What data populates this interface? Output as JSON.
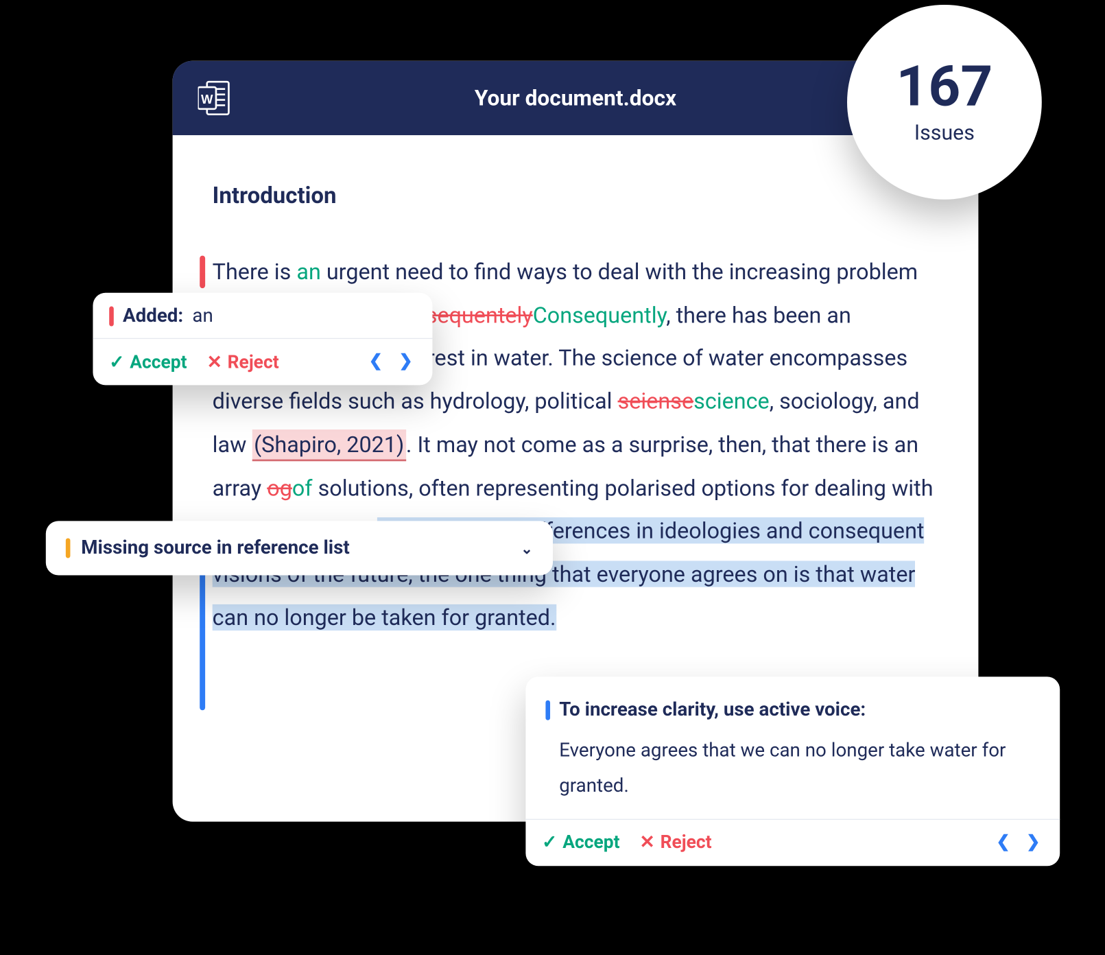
{
  "header": {
    "filename": "Your document.docx"
  },
  "issues": {
    "count": "167",
    "label": "Issues"
  },
  "content": {
    "heading": "Introduction",
    "p1_pre": "There is ",
    "p1_ins_an": "an",
    "p1_after_an": " urgent need to find ways to deal with the increasing problem of water scarcity. ",
    "p1_del_conseq": "Consequentely",
    "p1_ins_conseq": "Consequently",
    "p1_after_conseq": ", there has been an increase in global interest in water. The science of water encompasses diverse fields such as hydrology, political ",
    "p1_del_sci": "seiense",
    "p1_ins_sci": "science",
    "p1_after_sci": ", sociology, and law ",
    "p1_citation": "(Shapiro, 2021)",
    "p1_after_cite": ". It may not come as a surprise, then, that there is an array ",
    "p1_del_og": "og",
    "p1_ins_of": "of",
    "p1_after_of": " solutions, often representing polarised options for dealing with water problems.  ",
    "p1_blue_sel": "Regardless of differences in ideologies and consequent visions of the future, the one thing that everyone agrees on is that water can no longer be taken for granted."
  },
  "popups": {
    "added": {
      "label": "Added:",
      "word": "an",
      "accept": "Accept",
      "reject": "Reject"
    },
    "missing": {
      "text": "Missing source in reference list"
    },
    "clarity": {
      "title": "To increase clarity, use active voice:",
      "suggestion": "Everyone agrees that we can no longer take water for granted.",
      "accept": "Accept",
      "reject": "Reject"
    }
  }
}
